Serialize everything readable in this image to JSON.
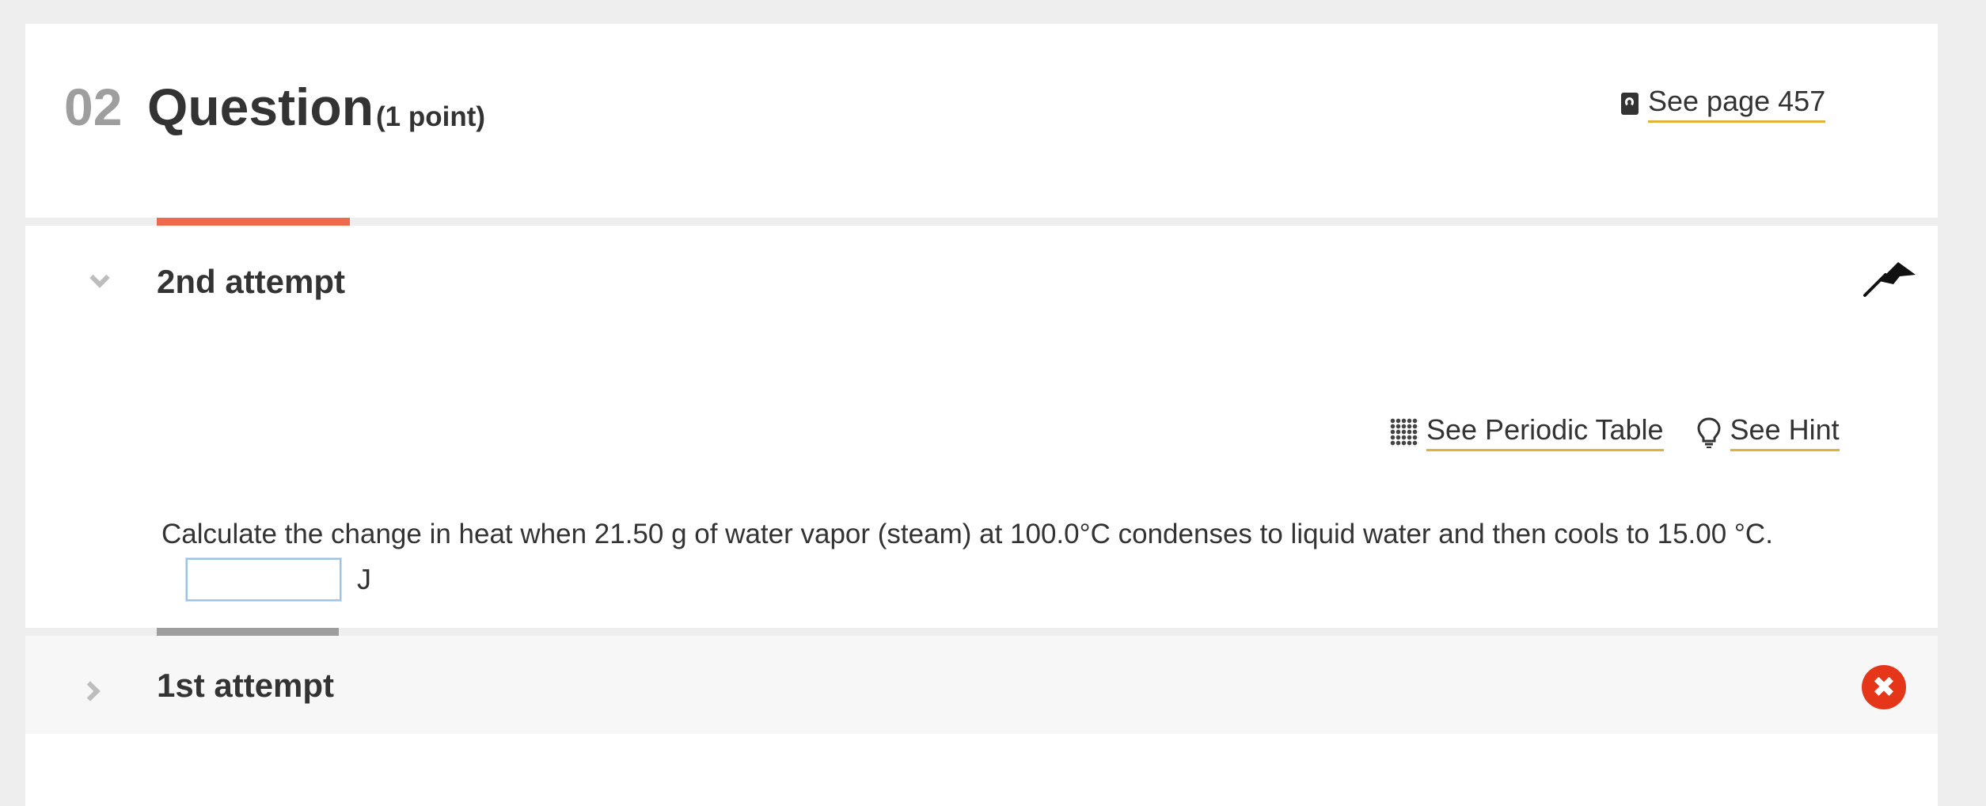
{
  "colors": {
    "accent_active": "#ef6a4c",
    "accent_inactive": "#9e9e9e",
    "link_underline": "#e0b23a",
    "error_badge": "#e53619"
  },
  "header": {
    "number": "02",
    "title": "Question",
    "points": "(1 point)",
    "see_page_label": "See page 457",
    "see_page_icon": "ebook-icon"
  },
  "attempt2": {
    "title": "2nd attempt",
    "expanded": true,
    "flag_icon": "flag-icon",
    "tools": [
      {
        "label": "See Periodic Table",
        "icon": "periodic-table-icon"
      },
      {
        "label": "See Hint",
        "icon": "lightbulb-icon"
      }
    ],
    "question": "Calculate the change in heat when 21.50  g of water vapor (steam) at 100.0°C condenses to liquid water and then cools to 15.00 °C.",
    "answer_value": "",
    "unit": "J"
  },
  "attempt1": {
    "title": "1st attempt",
    "expanded": false,
    "status_icon": "incorrect-x-icon",
    "status_glyph": "✖"
  }
}
